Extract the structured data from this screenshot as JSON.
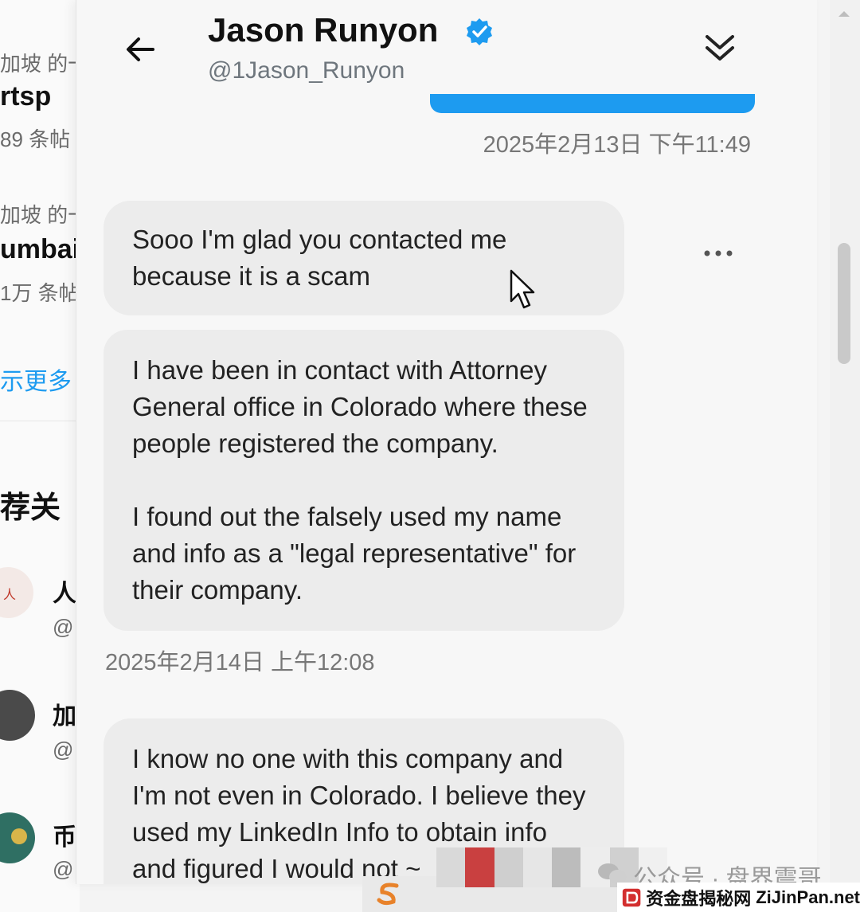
{
  "background_timeline": {
    "row1_meta": "加坡 的一",
    "row1_title": "rtsp",
    "row1_count": "89 条帖",
    "row2_meta": "加坡 的一",
    "row2_title": "umbai",
    "row2_count": "1万 条帖",
    "show_more": "示更多",
    "section_heading": "荐关",
    "users": [
      {
        "name": "人",
        "handle": "@"
      },
      {
        "name": "加",
        "handle": "@"
      },
      {
        "name": "币",
        "handle": "@"
      }
    ]
  },
  "dm_header": {
    "name": "Jason Runyon",
    "handle": "@1Jason_Runyon",
    "verified": true
  },
  "timestamps": {
    "first": "2025年2月13日 下午11:49",
    "second": "2025年2月14日 上午12:08"
  },
  "messages": [
    {
      "paragraphs": [
        "Sooo I'm glad you contacted me because it is a scam"
      ]
    },
    {
      "paragraphs": [
        "I have been in contact with Attorney General office in Colorado where these people registered the company.",
        "I found out the falsely used my name and info as a \"legal representative\" for their company."
      ]
    },
    {
      "paragraphs": [
        "I know no one with this company and I'm not even in Colorado.  I believe they used my LinkedIn Info to obtain info and figured I would not ~"
      ]
    }
  ],
  "watermarks": {
    "wechat": "公众号 · 盘界震哥",
    "site_cn": "资金盘揭秘网",
    "site_en": "ZiJinPan.net"
  },
  "colors": {
    "accent": "#1d9bf0",
    "bubble": "#ececec",
    "panel": "#f7f7f7"
  },
  "icons": [
    "back-arrow-icon",
    "verified-badge-icon",
    "collapse-icon",
    "more-icon",
    "mouse-cursor-icon",
    "wechat-icon",
    "site-logo-icon"
  ]
}
